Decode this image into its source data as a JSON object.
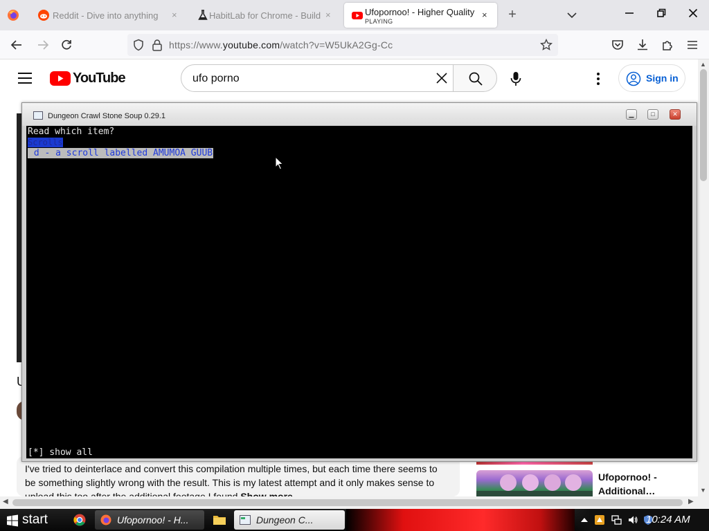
{
  "browser": {
    "tabs": [
      {
        "title": "Reddit - Dive into anything",
        "close": "×"
      },
      {
        "title": "HabitLab for Chrome - Build",
        "close": "×"
      },
      {
        "title": "Ufopornoo! - Higher Quality",
        "subtitle": "PLAYING",
        "close": "×"
      }
    ],
    "new_tab": "+",
    "url_prefix": "https://www.",
    "url_domain": "youtube.com",
    "url_path": "/watch?v=W5UkA2Gg-Cc"
  },
  "youtube": {
    "logo_text": "YouTube",
    "search_value": "ufo porno",
    "sign_in": "Sign in",
    "title_fragment": "U",
    "description": "I've tried to deinterlace and convert this compilation multiple times, but each time there seems to be something slightly wrong with the result. This is my latest attempt and it only makes sense to upload this too after the additional footage I found",
    "show_more": "Show more",
    "rec_title": "Ufopornoo! - Additional…"
  },
  "dcss": {
    "window_title": "Dungeon Crawl Stone Soup 0.29.1",
    "prompt": "Read which item?",
    "category": "Scrolls",
    "item": " d - a scroll labelled AMUMOA GUUB",
    "footer": "[*] show all"
  },
  "taskbar": {
    "start": "start",
    "firefox_label": "Ufopornoo! - H...",
    "dcss_label": "Dungeon C...",
    "clock": "10:24 AM"
  },
  "colors": {
    "youtube_red": "#ff0000",
    "signin_blue": "#065fd4",
    "terminal_bg": "#000000",
    "highlight_item": "#1f3adb"
  }
}
